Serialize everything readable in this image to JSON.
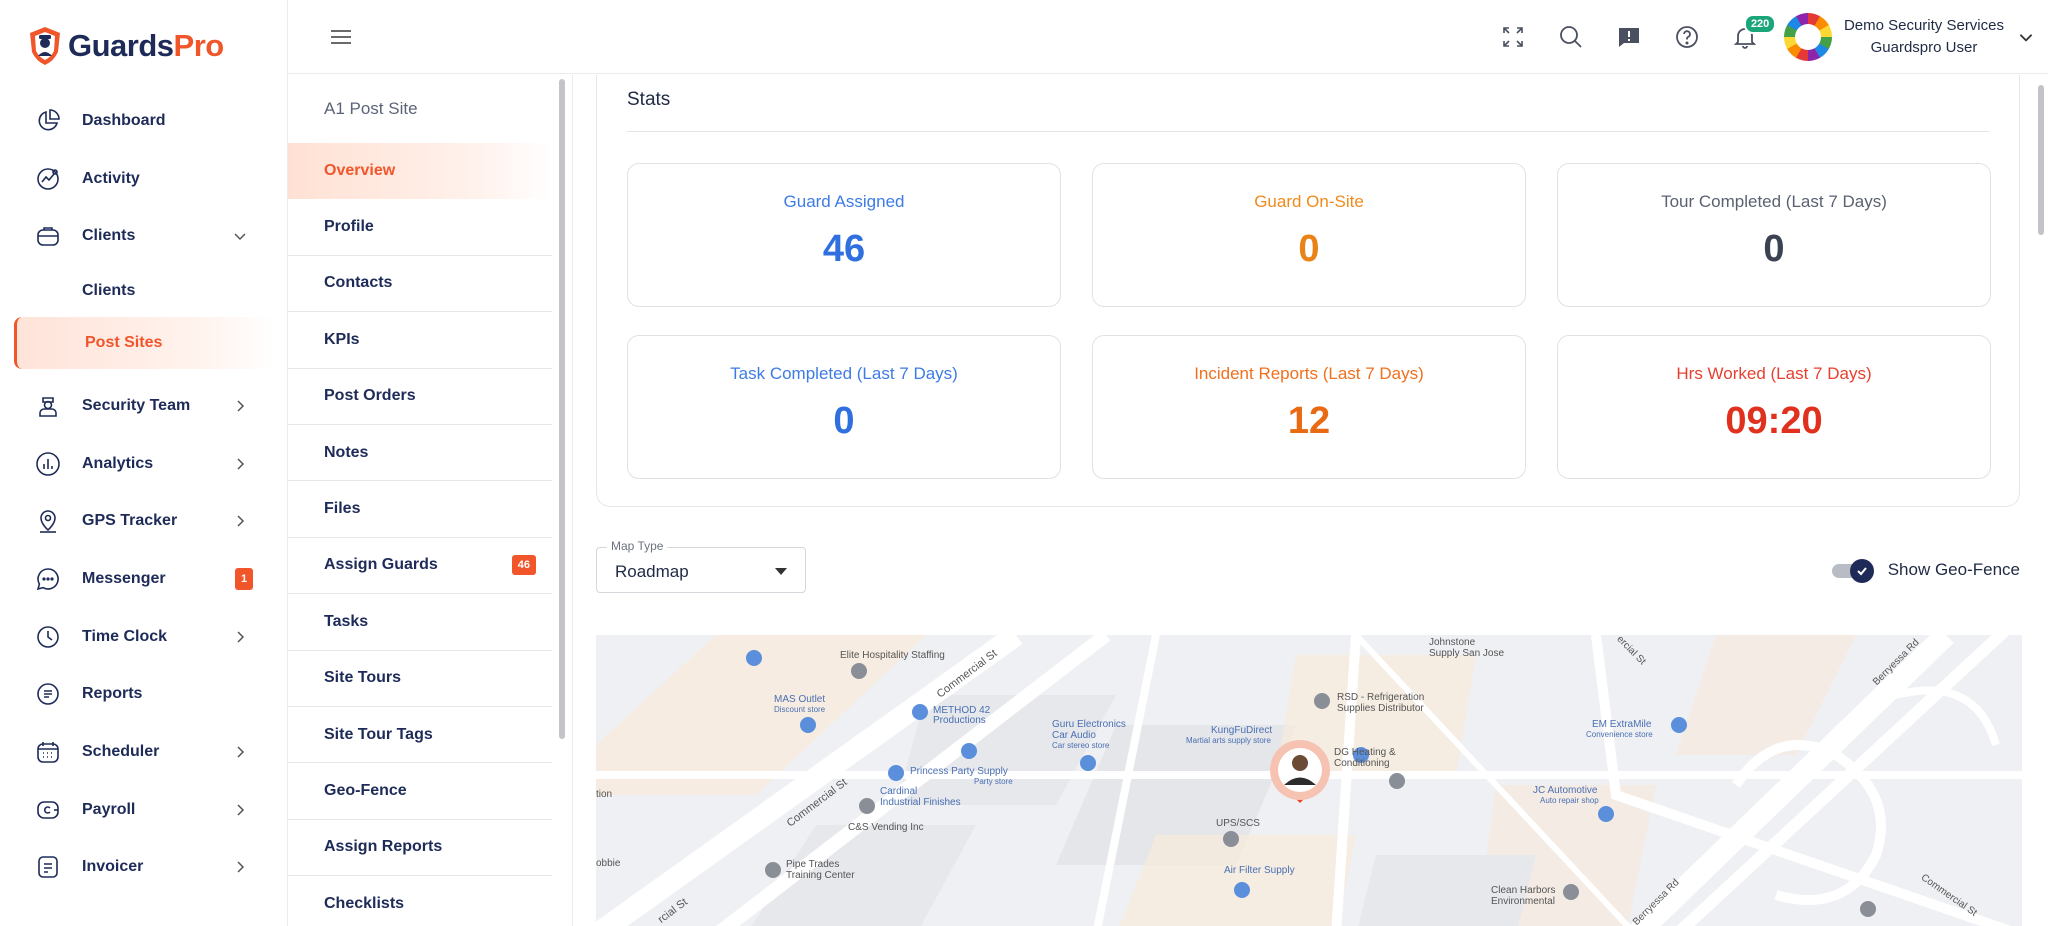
{
  "brand": {
    "part1": "Guards",
    "part2": "Pro"
  },
  "sidebar": {
    "items": [
      {
        "label": "Dashboard",
        "icon": "pie-chart-icon"
      },
      {
        "label": "Activity",
        "icon": "activity-icon"
      },
      {
        "label": "Clients",
        "icon": "briefcase-icon",
        "expanded": true
      }
    ],
    "sub_items": [
      {
        "label": "Clients"
      },
      {
        "label": "Post Sites",
        "active": true
      }
    ],
    "items2": [
      {
        "label": "Security Team",
        "icon": "guard-icon"
      },
      {
        "label": "Analytics",
        "icon": "analytics-icon"
      },
      {
        "label": "GPS Tracker",
        "icon": "location-pin-icon"
      },
      {
        "label": "Messenger",
        "icon": "chat-bubble-icon",
        "badge": "1"
      },
      {
        "label": "Time Clock",
        "icon": "clock-icon"
      },
      {
        "label": "Reports",
        "icon": "report-icon"
      },
      {
        "label": "Scheduler",
        "icon": "calendar-icon"
      },
      {
        "label": "Payroll",
        "icon": "wallet-icon"
      },
      {
        "label": "Invoicer",
        "icon": "invoice-icon"
      }
    ]
  },
  "header": {
    "notification_count": "220",
    "user_company": "Demo Security Services",
    "user_role": "Guardspro User",
    "icons": [
      "fullscreen-icon",
      "search-icon",
      "feedback-icon",
      "help-icon",
      "bell-icon"
    ]
  },
  "postsite": {
    "title": "A1 Post Site",
    "menu": [
      {
        "label": "Overview",
        "active": true
      },
      {
        "label": "Profile"
      },
      {
        "label": "Contacts"
      },
      {
        "label": "KPIs"
      },
      {
        "label": "Post Orders"
      },
      {
        "label": "Notes"
      },
      {
        "label": "Files"
      },
      {
        "label": "Assign Guards",
        "badge": "46"
      },
      {
        "label": "Tasks"
      },
      {
        "label": "Site Tours"
      },
      {
        "label": "Site Tour Tags"
      },
      {
        "label": "Geo-Fence"
      },
      {
        "label": "Assign Reports"
      },
      {
        "label": "Checklists"
      }
    ]
  },
  "stats": {
    "title": "Stats",
    "cards": [
      {
        "label": "Guard Assigned",
        "value": "46",
        "label_color": "#3d7be6",
        "value_color": "#2f6fe0"
      },
      {
        "label": "Guard On-Site",
        "value": "0",
        "label_color": "#f08a1c",
        "value_color": "#e98318"
      },
      {
        "label": "Tour Completed (Last 7 Days)",
        "value": "0",
        "label_color": "#5a6272",
        "value_color": "#3b4252"
      },
      {
        "label": "Task Completed (Last 7 Days)",
        "value": "0",
        "label_color": "#3d7be6",
        "value_color": "#2f6fe0"
      },
      {
        "label": "Incident Reports (Last 7 Days)",
        "value": "12",
        "label_color": "#f0701e",
        "value_color": "#ea6a14"
      },
      {
        "label": "Hrs Worked (Last 7 Days)",
        "value": "09:20",
        "label_color": "#e8402e",
        "value_color": "#e0301e"
      }
    ]
  },
  "map_controls": {
    "map_type_label": "Map Type",
    "map_type_value": "Roadmap",
    "geofence_label": "Show Geo-Fence",
    "geofence_on": true
  },
  "map": {
    "labels": [
      {
        "text": "Elite Hospitality Staffing"
      },
      {
        "text": "Commercial St"
      },
      {
        "text": "Johnstone"
      },
      {
        "text": "Supply San Jose"
      },
      {
        "text": "RSD - Refrigeration"
      },
      {
        "text": "Supplies Distributor"
      },
      {
        "text": "MAS Outlet"
      },
      {
        "text": "Discount store"
      },
      {
        "text": "METHOD 42"
      },
      {
        "text": "Productions"
      },
      {
        "text": "Guru Electronics"
      },
      {
        "text": "Car Audio"
      },
      {
        "text": "Car stereo store"
      },
      {
        "text": "KungFuDirect"
      },
      {
        "text": "Martial arts supply store"
      },
      {
        "text": "DG Heating &"
      },
      {
        "text": "Conditioning"
      },
      {
        "text": "EM ExtraMile"
      },
      {
        "text": "Convenience store"
      },
      {
        "text": "Princess Party Supply"
      },
      {
        "text": "Party store"
      },
      {
        "text": "Commercial St"
      },
      {
        "text": "Cardinal"
      },
      {
        "text": "Industrial Finishes"
      },
      {
        "text": "C&S Vending Inc"
      },
      {
        "text": "UPS/SCS"
      },
      {
        "text": "JC Automotive"
      },
      {
        "text": "Auto repair shop"
      },
      {
        "text": "Pipe Trades"
      },
      {
        "text": "Training Center"
      },
      {
        "text": "Air Filter Supply"
      },
      {
        "text": "Clean Harbors"
      },
      {
        "text": "Environmental"
      },
      {
        "text": "Berryessa Rd"
      },
      {
        "text": "Berryessa Rd"
      },
      {
        "text": "ercial St"
      },
      {
        "text": "rcial St"
      },
      {
        "text": "Commercial St"
      },
      {
        "text": "tion"
      },
      {
        "text": "obbie"
      }
    ]
  }
}
